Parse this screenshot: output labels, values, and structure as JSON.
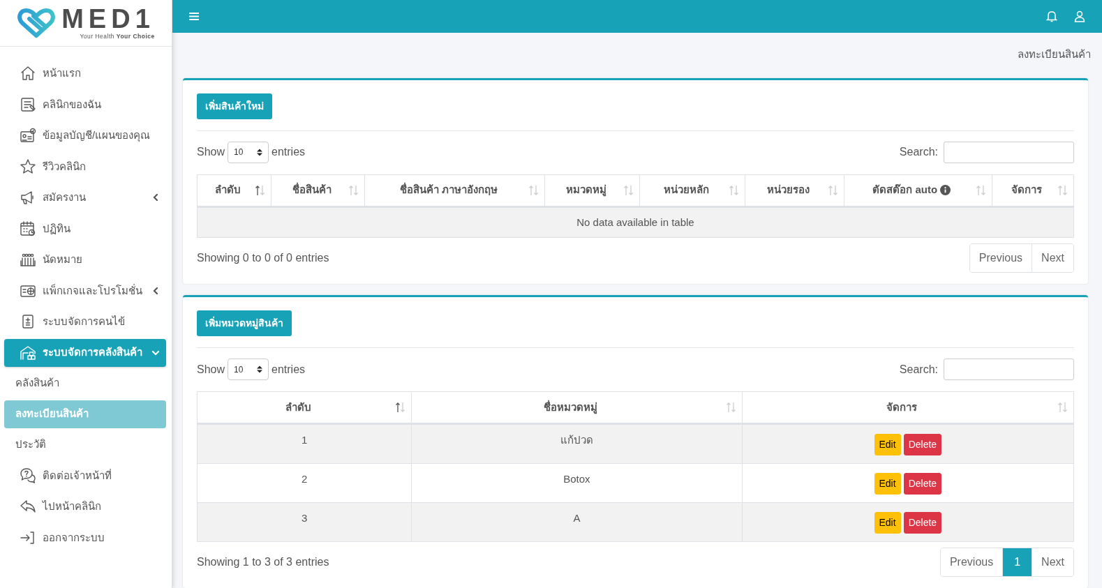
{
  "logo": {
    "name": "MED1",
    "tagline": "Your Health **Your Choice**"
  },
  "sidebar": {
    "items": [
      {
        "label": "หน้าแรก",
        "selected": false
      },
      {
        "label": "คลินิกของฉัน",
        "selected": false
      },
      {
        "label": "ข้อมูลบัญชี/แผนของคุณ",
        "selected": false
      },
      {
        "label": "รีวิวคลินิก",
        "selected": false
      },
      {
        "label": "สมัครงาน",
        "selected": false,
        "expanded": false
      },
      {
        "label": "ปฏิทิน",
        "selected": false
      },
      {
        "label": "นัดหมาย",
        "selected": false
      },
      {
        "label": "แพ็กเกจและโปรโมชั่น",
        "selected": false,
        "expanded": false
      },
      {
        "label": "ระบบจัดการคนไข้",
        "selected": false
      },
      {
        "label": "ระบบจัดการคลังสินค้า",
        "selected": true,
        "expanded": true,
        "children": [
          {
            "label": "คลังสินค้า",
            "selected": false
          },
          {
            "label": "ลงทะเบียนสินค้า",
            "selected": true
          },
          {
            "label": "ประวัติ",
            "selected": false
          }
        ]
      },
      {
        "label": "ติดต่อเจ้าหน้าที่",
        "selected": false
      },
      {
        "label": "ไปหน้าคลินิก",
        "selected": false
      },
      {
        "label": "ออกจากระบบ",
        "selected": false
      }
    ]
  },
  "breadcrumb": "ลงทะเบียนสินค้า",
  "panels": [
    {
      "add_button": "เพิ่มสินค้าใหม่",
      "show_label": "Show",
      "length_value": "10",
      "entries_label": "entries",
      "search_label": "Search:",
      "columns": [
        {
          "label": "ลำดับ",
          "sorted": true
        },
        {
          "label": "ชื่อสินค้า",
          "sorted": false
        },
        {
          "label": "ชื่อสินค้า ภาษาอังกฤษ",
          "sorted": false
        },
        {
          "label": "หมวดหมู่",
          "sorted": false
        },
        {
          "label": "หน่วยหลัก",
          "sorted": false
        },
        {
          "label": "หน่วยรอง",
          "sorted": false
        },
        {
          "label": "ตัดสต๊อก auto",
          "sorted": false,
          "info_icon": true
        },
        {
          "label": "จัดการ",
          "sorted": false
        }
      ],
      "empty_message": "No data available in table",
      "info": "Showing 0 to 0 of 0 entries",
      "pagination": [
        {
          "label": "Previous",
          "selected": false
        },
        {
          "label": "Next",
          "selected": false
        }
      ]
    },
    {
      "add_button": "เพิ่มหมวดหมู่สินค้า",
      "show_label": "Show",
      "length_value": "10",
      "entries_label": "entries",
      "search_label": "Search:",
      "columns": [
        {
          "label": "ลำดับ",
          "sorted": true
        },
        {
          "label": "ชื่อหมวดหมู่",
          "sorted": false
        },
        {
          "label": "จัดการ",
          "sorted": false
        }
      ],
      "rows": [
        {
          "cells": [
            "1",
            "แก้ปวด"
          ],
          "actions": [
            {
              "label": "Edit",
              "kind": "warning"
            },
            {
              "label": "Delete",
              "kind": "danger"
            }
          ]
        },
        {
          "cells": [
            "2",
            "Botox"
          ],
          "actions": [
            {
              "label": "Edit",
              "kind": "warning"
            },
            {
              "label": "Delete",
              "kind": "danger"
            }
          ]
        },
        {
          "cells": [
            "3",
            "A"
          ],
          "actions": [
            {
              "label": "Edit",
              "kind": "warning"
            },
            {
              "label": "Delete",
              "kind": "danger"
            }
          ]
        }
      ],
      "info": "Showing 1 to 3 of 3 entries",
      "pagination": [
        {
          "label": "Previous",
          "selected": false
        },
        {
          "label": "1",
          "selected": true
        },
        {
          "label": "Next",
          "selected": false
        }
      ]
    }
  ]
}
